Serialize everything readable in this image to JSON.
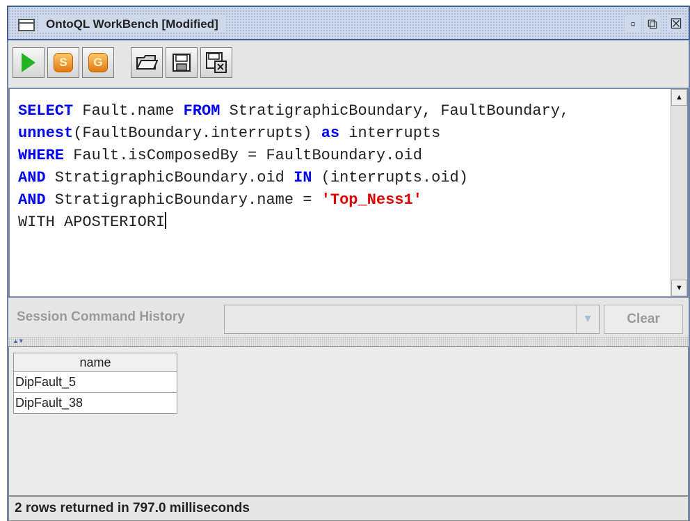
{
  "window": {
    "title": "OntoQL WorkBench [Modified]",
    "buttons": {
      "minimize": "▫",
      "maximize": "⧉",
      "close": "☒"
    }
  },
  "toolbar": {
    "run": "run-icon",
    "s_label": "S",
    "g_label": "G",
    "open": "folder-icon",
    "save": "floppy-icon",
    "save_as": "floppy-x-icon"
  },
  "editor": {
    "lines": [
      [
        {
          "t": "SELECT",
          "c": "kw"
        },
        {
          "t": " Fault.name ",
          "c": ""
        },
        {
          "t": "FROM",
          "c": "kw"
        },
        {
          "t": " StratigraphicBoundary, FaultBoundary,",
          "c": ""
        }
      ],
      [
        {
          "t": "unnest",
          "c": "kw"
        },
        {
          "t": "(FaultBoundary.interrupts) ",
          "c": ""
        },
        {
          "t": "as",
          "c": "kw"
        },
        {
          "t": " interrupts",
          "c": ""
        }
      ],
      [
        {
          "t": "WHERE",
          "c": "kw"
        },
        {
          "t": " Fault.isComposedBy = FaultBoundary.oid",
          "c": ""
        }
      ],
      [
        {
          "t": "AND",
          "c": "kw"
        },
        {
          "t": " StratigraphicBoundary.oid ",
          "c": ""
        },
        {
          "t": "IN",
          "c": "kw"
        },
        {
          "t": " (interrupts.oid)",
          "c": ""
        }
      ],
      [
        {
          "t": "AND",
          "c": "kw"
        },
        {
          "t": " StratigraphicBoundary.name = ",
          "c": ""
        },
        {
          "t": "'Top_Ness1'",
          "c": "str"
        }
      ],
      [
        {
          "t": "WITH APOSTERIORI",
          "c": ""
        }
      ]
    ]
  },
  "history": {
    "label": "Session Command History",
    "value": "",
    "clear": "Clear"
  },
  "results": {
    "columns": [
      "name"
    ],
    "rows": [
      [
        "DipFault_5"
      ],
      [
        "DipFault_38"
      ]
    ]
  },
  "status": {
    "text": "2 rows returned in 797.0 milliseconds"
  }
}
